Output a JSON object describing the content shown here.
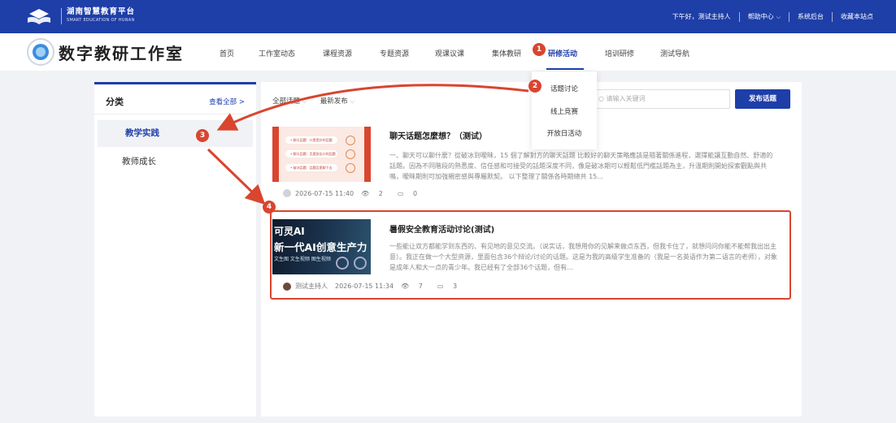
{
  "topbar": {
    "brand_cn": "湖南智慧教育平台",
    "brand_en": "SMART EDUCATION OF HUNAN",
    "greeting": "下午好，测试主持人",
    "help": "帮助中心",
    "admin": "系统后台",
    "favorite": "收藏本站点"
  },
  "header": {
    "title": "数字教研工作室",
    "nav": [
      "首页",
      "工作室动态",
      "课程资源",
      "专题资源",
      "观课议课",
      "集体教研",
      "研修活动",
      "培训研修",
      "测试导航"
    ],
    "active_nav": "研修活动"
  },
  "dropdown": {
    "items": [
      "话题讨论",
      "线上竞赛",
      "开放日活动"
    ]
  },
  "sidebar": {
    "title": "分类",
    "view_all": "查看全部 >",
    "categories": [
      "教学实践",
      "教师成长"
    ],
    "active_category": "教学实践"
  },
  "toolbar": {
    "filter_all": "全部话题",
    "filter_sort": "最新发布",
    "search_placeholder": "请输入关键词",
    "publish": "发布话题"
  },
  "posts": [
    {
      "title": "聊天话题怎麼想？（测试）",
      "excerpt": "一、聊天可以聊什麼？從破冰到曖昧，15 個了解對方的聊天話題 比較好的聊天策略應該是隨著關係進程，選擇能讓互動自然、舒適的話題。因為不同階段的熟悉度、信任感和可接受的話題深度不同，像是破冰期可以輕鬆低門檻話題為主，升溫期則開始探索觀點與共鳴，曖昧期則可加強親密感與專屬默契。 以下整理了關係各時期總共 15...",
      "time": "2026-07-15 11:40",
      "views": "2",
      "comments": "0",
      "thumb_lines": [
        "• 聊天話題：什麼是好的話題",
        "• 聊天話題：怎麼說出口的話題",
        "• 破冰話題：話題怎麼聊下去"
      ]
    },
    {
      "title": "暑假安全教育活动讨论(测试)",
      "excerpt": "一些能让双方都能学到东西的、有见地的意见交流。（说实话，我想用你的见解来做点东西，但我卡住了，就想问问你能不能帮我出出主意）。我正在做一个大型资源，里面包含36个辩论/讨论的话题。这是为我的高级学生准备的（我是一名英语作为第二语言的老师），对象是成年人和大一点的青少年。我已经有了全部36个话题，但有...",
      "author": "测试主持人",
      "time": "2026-07-15 11:34",
      "views": "7",
      "comments": "3",
      "thumb_line1": "可灵AI",
      "thumb_line2": "新一代AI创意生产力",
      "thumb_line3": "文生图 文生视频 图生视频"
    }
  ],
  "annotations": [
    "1",
    "2",
    "3",
    "4"
  ],
  "colors": {
    "brand_blue": "#1e3ea8",
    "annotation_red": "#d9452f"
  }
}
